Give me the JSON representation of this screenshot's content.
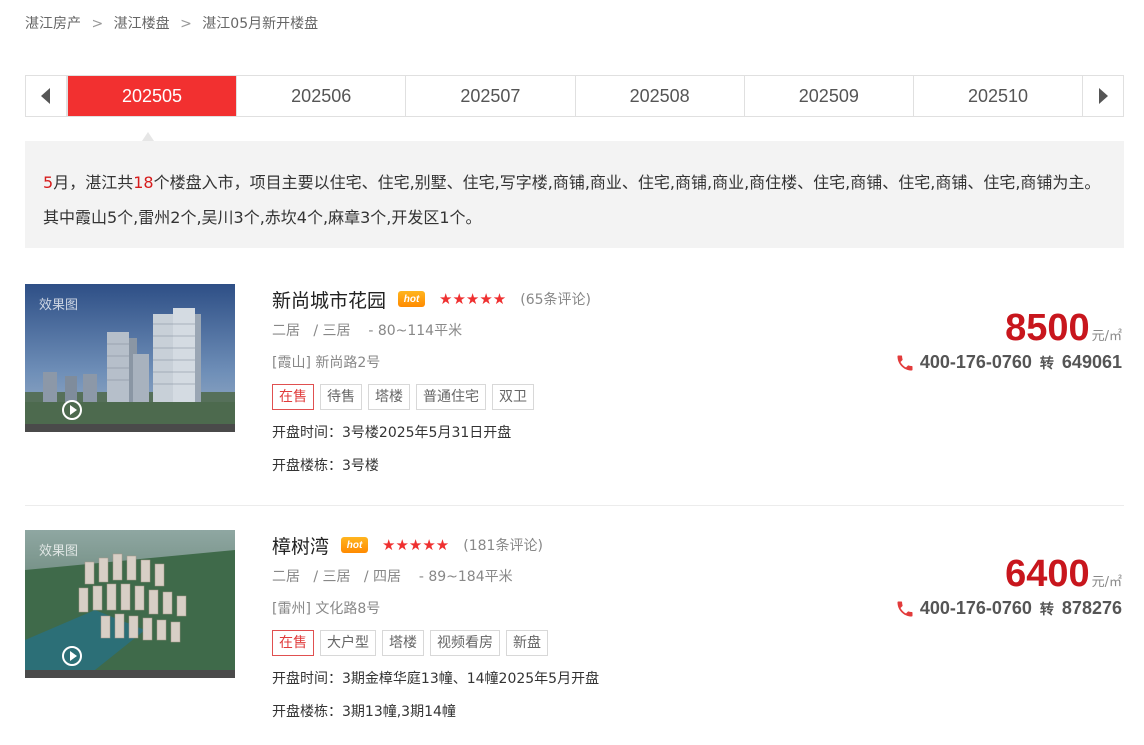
{
  "breadcrumb": {
    "items": [
      "湛江房产",
      "湛江楼盘",
      "湛江05月新开楼盘"
    ],
    "separator": ">"
  },
  "months": {
    "tabs": [
      "202505",
      "202506",
      "202507",
      "202508",
      "202509",
      "202510"
    ],
    "active_index": 0
  },
  "summary": {
    "month_num": "5",
    "part1": "月，湛江共",
    "count": "18",
    "part2": "个楼盘入市，项目主要以住宅、住宅,别墅、住宅,写字楼,商铺,商业、住宅,商铺,商业,商住楼、住宅,商铺、住宅,商铺、住宅,商铺为主。其中霞山5个,雷州2个,吴川3个,赤坎4个,麻章3个,开发区1个。"
  },
  "listings": [
    {
      "thumb_label": "效果图",
      "name": "新尚城市花园",
      "hot_label": "hot",
      "stars": "★★★★★",
      "reviews": "(65条评论)",
      "layout": "二居   / 三居    - 80~114平米",
      "address": "[霞山] 新尚路2号",
      "tags": [
        "在售",
        "待售",
        "塔楼",
        "普通住宅",
        "双卫"
      ],
      "open_time": "开盘时间：3号楼2025年5月31日开盘",
      "open_building": "开盘楼栋：3号楼",
      "price": "8500",
      "price_unit": "元/㎡",
      "phone": "400-176-0760",
      "ext_label": "转",
      "ext": "649061"
    },
    {
      "thumb_label": "效果图",
      "name": "樟树湾",
      "hot_label": "hot",
      "stars": "★★★★★",
      "reviews": "(181条评论)",
      "layout": "二居   / 三居   / 四居    - 89~184平米",
      "address": "[雷州] 文化路8号",
      "tags": [
        "在售",
        "大户型",
        "塔楼",
        "视频看房",
        "新盘"
      ],
      "open_time": "开盘时间：3期金樟华庭13幢、14幢2025年5月开盘",
      "open_building": "开盘楼栋：3期13幢,3期14幢",
      "price": "6400",
      "price_unit": "元/㎡",
      "phone": "400-176-0760",
      "ext_label": "转",
      "ext": "878276"
    }
  ],
  "colors": {
    "accent_red": "#f23030",
    "price_red": "#c8161d",
    "summary_bg": "#f3f3f3"
  }
}
